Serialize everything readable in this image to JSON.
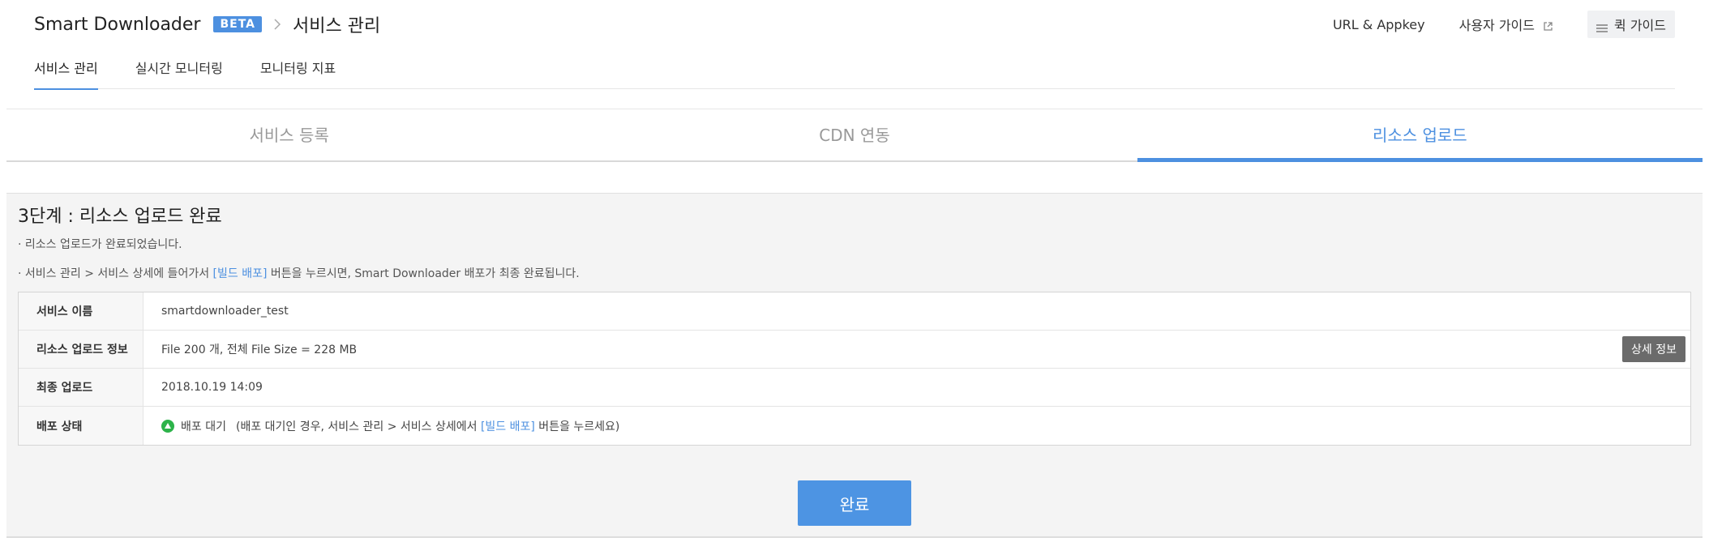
{
  "header": {
    "app_title": "Smart Downloader",
    "badge": "BETA",
    "breadcrumb_sep": ">",
    "current_page": "서비스 관리",
    "links": {
      "url_appkey": "URL & Appkey",
      "user_guide": "사용자 가이드",
      "quick_guide": "퀵 가이드"
    }
  },
  "top_tabs": [
    {
      "label": "서비스 관리",
      "active": true
    },
    {
      "label": "실시간 모니터링",
      "active": false
    },
    {
      "label": "모니터링 지표",
      "active": false
    }
  ],
  "steps": [
    {
      "label": "서비스 등록",
      "active": false
    },
    {
      "label": "CDN 연동",
      "active": false
    },
    {
      "label": "리소스 업로드",
      "active": true
    }
  ],
  "content": {
    "title": "3단계 : 리소스 업로드 완료",
    "note1": "· 리소스 업로드가 완료되었습니다.",
    "note2_prefix": "· 서비스 관리 > 서비스 상세에 들어가서 ",
    "note2_link": "[빌드 배포]",
    "note2_suffix": " 버튼을 누르시면, Smart Downloader 배포가 최종 완료됩니다.",
    "table": {
      "service_name_label": "서비스 이름",
      "service_name_value": "smartdownloader_test",
      "upload_info_label": "리소스 업로드 정보",
      "upload_info_value": "File 200 개, 전체 File Size = 228 MB",
      "detail_button": "상세 정보",
      "last_upload_label": "최종 업로드",
      "last_upload_value": "2018.10.19 14:09",
      "deploy_status_label": "배포 상태",
      "deploy_status_value": "배포 대기",
      "deploy_note_prefix": "(배포 대기인 경우, 서비스 관리 > 서비스 상세에서 ",
      "deploy_note_link": "[빌드 배포]",
      "deploy_note_suffix": " 버튼을 누르세요)"
    },
    "done_button": "완료"
  },
  "colors": {
    "accent": "#4d90e0",
    "status_green": "#2db34a",
    "detail_button_bg": "#6b6b6b"
  },
  "icons": {
    "external_link": "external-link-icon",
    "quick_guide": "menu-icon",
    "breadcrumb": "chevron-right-icon",
    "status": "triangle-up-circle-icon"
  }
}
